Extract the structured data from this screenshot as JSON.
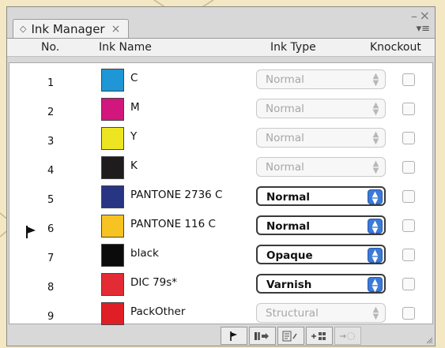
{
  "panel": {
    "tab_title": "Ink Manager",
    "tab_close": "×",
    "window_minimize": "–",
    "window_close": "×"
  },
  "columns": {
    "no": "No.",
    "ink_name": "Ink Name",
    "ink_type": "Ink Type",
    "knockout": "Knockout"
  },
  "inks": [
    {
      "no": "1",
      "name": "C",
      "color": "#1f96d6",
      "type": "Normal",
      "enabled": false,
      "knockout": false
    },
    {
      "no": "2",
      "name": "M",
      "color": "#d2167e",
      "type": "Normal",
      "enabled": false,
      "knockout": false
    },
    {
      "no": "3",
      "name": "Y",
      "color": "#eee522",
      "type": "Normal",
      "enabled": false,
      "knockout": false
    },
    {
      "no": "4",
      "name": "K",
      "color": "#1f1c1d",
      "type": "Normal",
      "enabled": false,
      "knockout": false
    },
    {
      "no": "5",
      "name": "PANTONE 2736 C",
      "color": "#283583",
      "type": "Normal",
      "enabled": true,
      "knockout": false
    },
    {
      "no": "6",
      "name": "PANTONE 116 C",
      "color": "#f7c323",
      "type": "Normal",
      "enabled": true,
      "knockout": false
    },
    {
      "no": "7",
      "name": "black",
      "color": "#0b0b0b",
      "type": "Opaque",
      "enabled": true,
      "knockout": false
    },
    {
      "no": "8",
      "name": "DIC 79s*",
      "color": "#e22b34",
      "type": "Varnish",
      "enabled": true,
      "knockout": false
    },
    {
      "no": "9",
      "name": "PackOther",
      "color": "#e01e26",
      "type": "Structural",
      "enabled": false,
      "knockout": false
    }
  ],
  "selected_row": "7",
  "icons": {
    "tab_icon": "◇",
    "panel_menu": "▾≡",
    "select_arrows": "▲▼",
    "row_marker": "flag-marker-icon",
    "footer": [
      "flag-icon",
      "ink-to-separation-icon",
      "edit-ink-icon",
      "add-ink-icon",
      "convert-icon"
    ]
  }
}
